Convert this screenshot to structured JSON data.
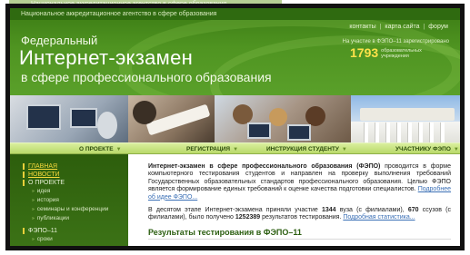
{
  "ghost_text": "Национальное аккредитационное агентство в сфере образования",
  "header": {
    "agency": "Национальное аккредитационное агентство в сфере образования",
    "brand_line1": "Федеральный",
    "brand_line2": "Интернет-экзамен",
    "brand_line3": "в сфере профессионального образования",
    "links": [
      "контакты",
      "карта сайта",
      "форум"
    ],
    "link_sep": "|",
    "counter_note": "На участие в ФЭПО–11 зарегистрировано",
    "counter_value": "1793",
    "counter_label": "образовательных учреждения"
  },
  "colors": {
    "header_green": "#4f9421",
    "sidebar_green": "#2d5e0c",
    "link_yellow": "#f6d83c",
    "counter_yellow": "#ffe24a",
    "content_link": "#3a6fb5"
  },
  "nav": {
    "items": [
      {
        "label": "О ПРОЕКТЕ",
        "icon": "chevron-down-icon"
      },
      {
        "label": "РЕГИСТРАЦИЯ",
        "icon": "chevron-down-icon"
      },
      {
        "label": "ИНСТРУКЦИЯ СТУДЕНТУ",
        "icon": "chevron-down-icon"
      },
      {
        "label": "УЧАСТНИКУ ФЭПО",
        "icon": "chevron-down-icon"
      }
    ]
  },
  "sidebar": {
    "items": [
      {
        "label": "ГЛАВНАЯ"
      },
      {
        "label": "НОВОСТИ"
      },
      {
        "label": "О ПРОЕКТЕ"
      },
      {
        "label": "идея"
      },
      {
        "label": "история"
      },
      {
        "label": "семинары и конференции"
      },
      {
        "label": "публикации"
      },
      {
        "label": "ФЭПО–11"
      },
      {
        "label": "сроки"
      }
    ]
  },
  "content": {
    "para1_bold": "Интернет-экзамен в сфере профессионального образования (ФЭПО)",
    "para1_text": " проводится в форме компьютерного тестирования студентов и направлен на проверку выполнения требований Государственных образовательных стандартов профессионального образования. Целью ФЭПО является формирование единых требований к оценке качества подготовки специалистов. ",
    "para1_more": "Подробнее об идее ФЭПО...",
    "para2_a": "В десятом этапе Интернет-экзамена приняли участие ",
    "para2_n1": "1344",
    "para2_b": " вуза (с филиалами), ",
    "para2_n2": "670",
    "para2_c": " ссузов (с филиалами), было получено ",
    "para2_n3": "1252389",
    "para2_d": " результатов тестирования. ",
    "para2_more": "Подробная статистика...",
    "section_title": "Результаты тестирования в ФЭПО–11"
  }
}
